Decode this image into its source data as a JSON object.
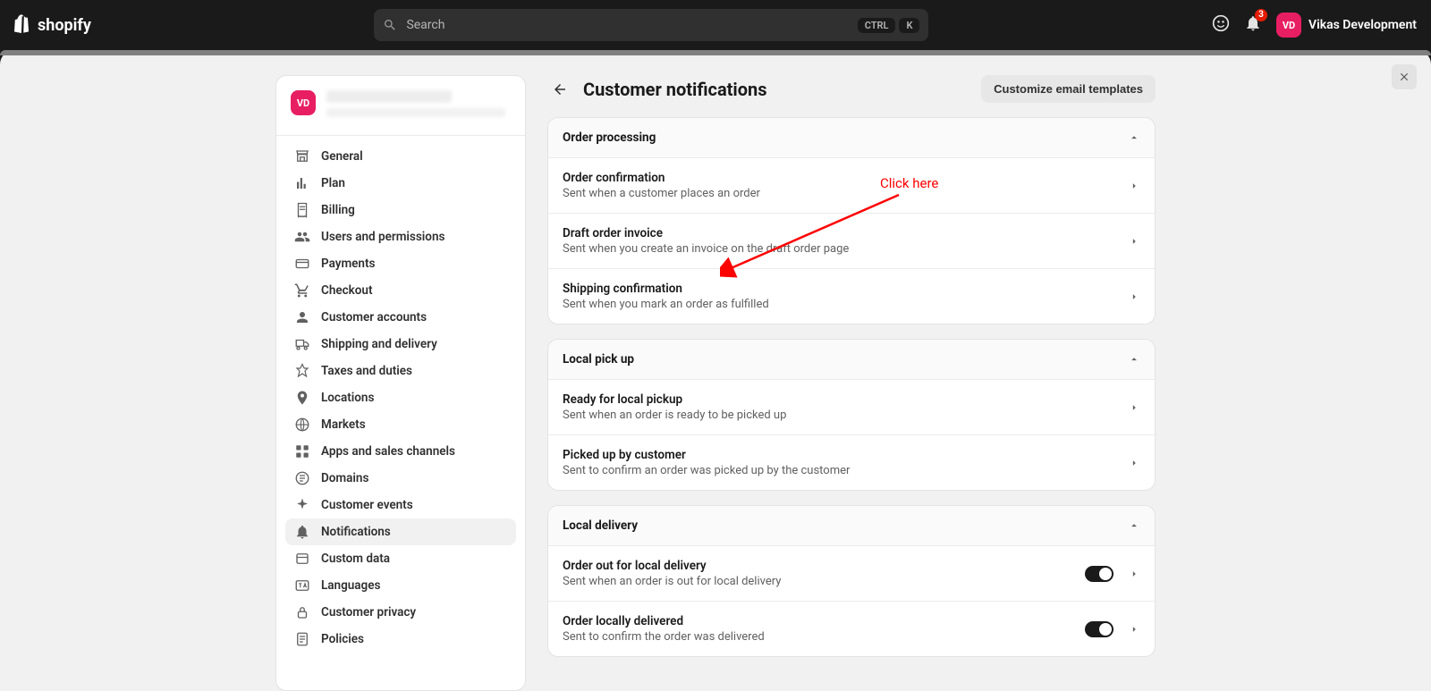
{
  "topbar": {
    "brand": "shopify",
    "search_placeholder": "Search",
    "kbd_ctrl": "CTRL",
    "kbd_k": "K",
    "notif_count": "3",
    "avatar_initials": "VD",
    "user_name": "Vikas Development"
  },
  "sidebar": {
    "avatar_initials": "VD",
    "items": [
      {
        "label": "General",
        "icon": "store"
      },
      {
        "label": "Plan",
        "icon": "chart"
      },
      {
        "label": "Billing",
        "icon": "receipt"
      },
      {
        "label": "Users and permissions",
        "icon": "users"
      },
      {
        "label": "Payments",
        "icon": "card"
      },
      {
        "label": "Checkout",
        "icon": "cart"
      },
      {
        "label": "Customer accounts",
        "icon": "person"
      },
      {
        "label": "Shipping and delivery",
        "icon": "truck"
      },
      {
        "label": "Taxes and duties",
        "icon": "taxes"
      },
      {
        "label": "Locations",
        "icon": "pin"
      },
      {
        "label": "Markets",
        "icon": "globe"
      },
      {
        "label": "Apps and sales channels",
        "icon": "apps"
      },
      {
        "label": "Domains",
        "icon": "domain"
      },
      {
        "label": "Customer events",
        "icon": "spark"
      },
      {
        "label": "Notifications",
        "icon": "bell",
        "active": true
      },
      {
        "label": "Custom data",
        "icon": "data"
      },
      {
        "label": "Languages",
        "icon": "lang"
      },
      {
        "label": "Customer privacy",
        "icon": "lock"
      },
      {
        "label": "Policies",
        "icon": "policy"
      }
    ]
  },
  "page": {
    "title": "Customer notifications",
    "customize_btn": "Customize email templates"
  },
  "annotation": {
    "label": "Click here"
  },
  "sections": [
    {
      "title": "Order processing",
      "rows": [
        {
          "title": "Order confirmation",
          "desc": "Sent when a customer places an order"
        },
        {
          "title": "Draft order invoice",
          "desc": "Sent when you create an invoice on the draft order page"
        },
        {
          "title": "Shipping confirmation",
          "desc": "Sent when you mark an order as fulfilled"
        }
      ]
    },
    {
      "title": "Local pick up",
      "rows": [
        {
          "title": "Ready for local pickup",
          "desc": "Sent when an order is ready to be picked up"
        },
        {
          "title": "Picked up by customer",
          "desc": "Sent to confirm an order was picked up by the customer"
        }
      ]
    },
    {
      "title": "Local delivery",
      "rows": [
        {
          "title": "Order out for local delivery",
          "desc": "Sent when an order is out for local delivery",
          "toggle": true
        },
        {
          "title": "Order locally delivered",
          "desc": "Sent to confirm the order was delivered",
          "toggle": true
        }
      ]
    }
  ]
}
